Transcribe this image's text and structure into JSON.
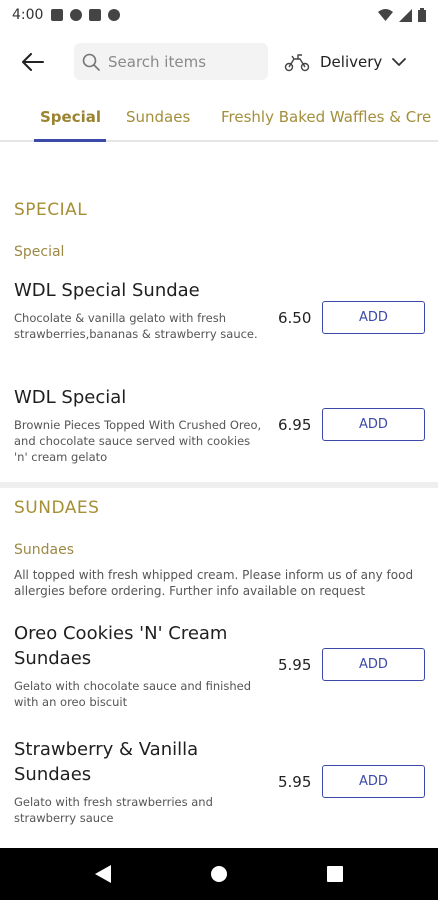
{
  "status": {
    "time": "4:00"
  },
  "header": {
    "search_placeholder": "Search items",
    "delivery_label": "Delivery"
  },
  "tabs": [
    "Special",
    "Sundaes",
    "Freshly Baked Waffles & Cre"
  ],
  "sections": [
    {
      "title": "SPECIAL",
      "subtitle": "Special",
      "items": [
        {
          "name": "WDL Special Sundae",
          "description": "Chocolate & vanilla gelato with fresh strawberries,bananas & strawberry sauce.",
          "price": "6.50",
          "button": "ADD"
        },
        {
          "name": "WDL Special",
          "description": "Brownie Pieces Topped With Crushed Oreo, and chocolate sauce served with cookies 'n' cream gelato",
          "price": "6.95",
          "button": "ADD"
        }
      ]
    },
    {
      "title": "SUNDAES",
      "subtitle": "Sundaes",
      "description": "All topped with fresh whipped cream. Please inform us of any food allergies before ordering. Further info available on request",
      "items": [
        {
          "name": "Oreo Cookies 'N' Cream Sundaes",
          "description": "Gelato with chocolate sauce and finished with an oreo biscuit",
          "price": "5.95",
          "button": "ADD"
        },
        {
          "name": "Strawberry & Vanilla Sundaes",
          "description": "Gelato with fresh strawberries and strawberry sauce",
          "price": "5.95",
          "button": "ADD"
        }
      ]
    }
  ],
  "colors": {
    "accent_gold": "#a68f35",
    "button_blue": "#3b4aa8"
  }
}
